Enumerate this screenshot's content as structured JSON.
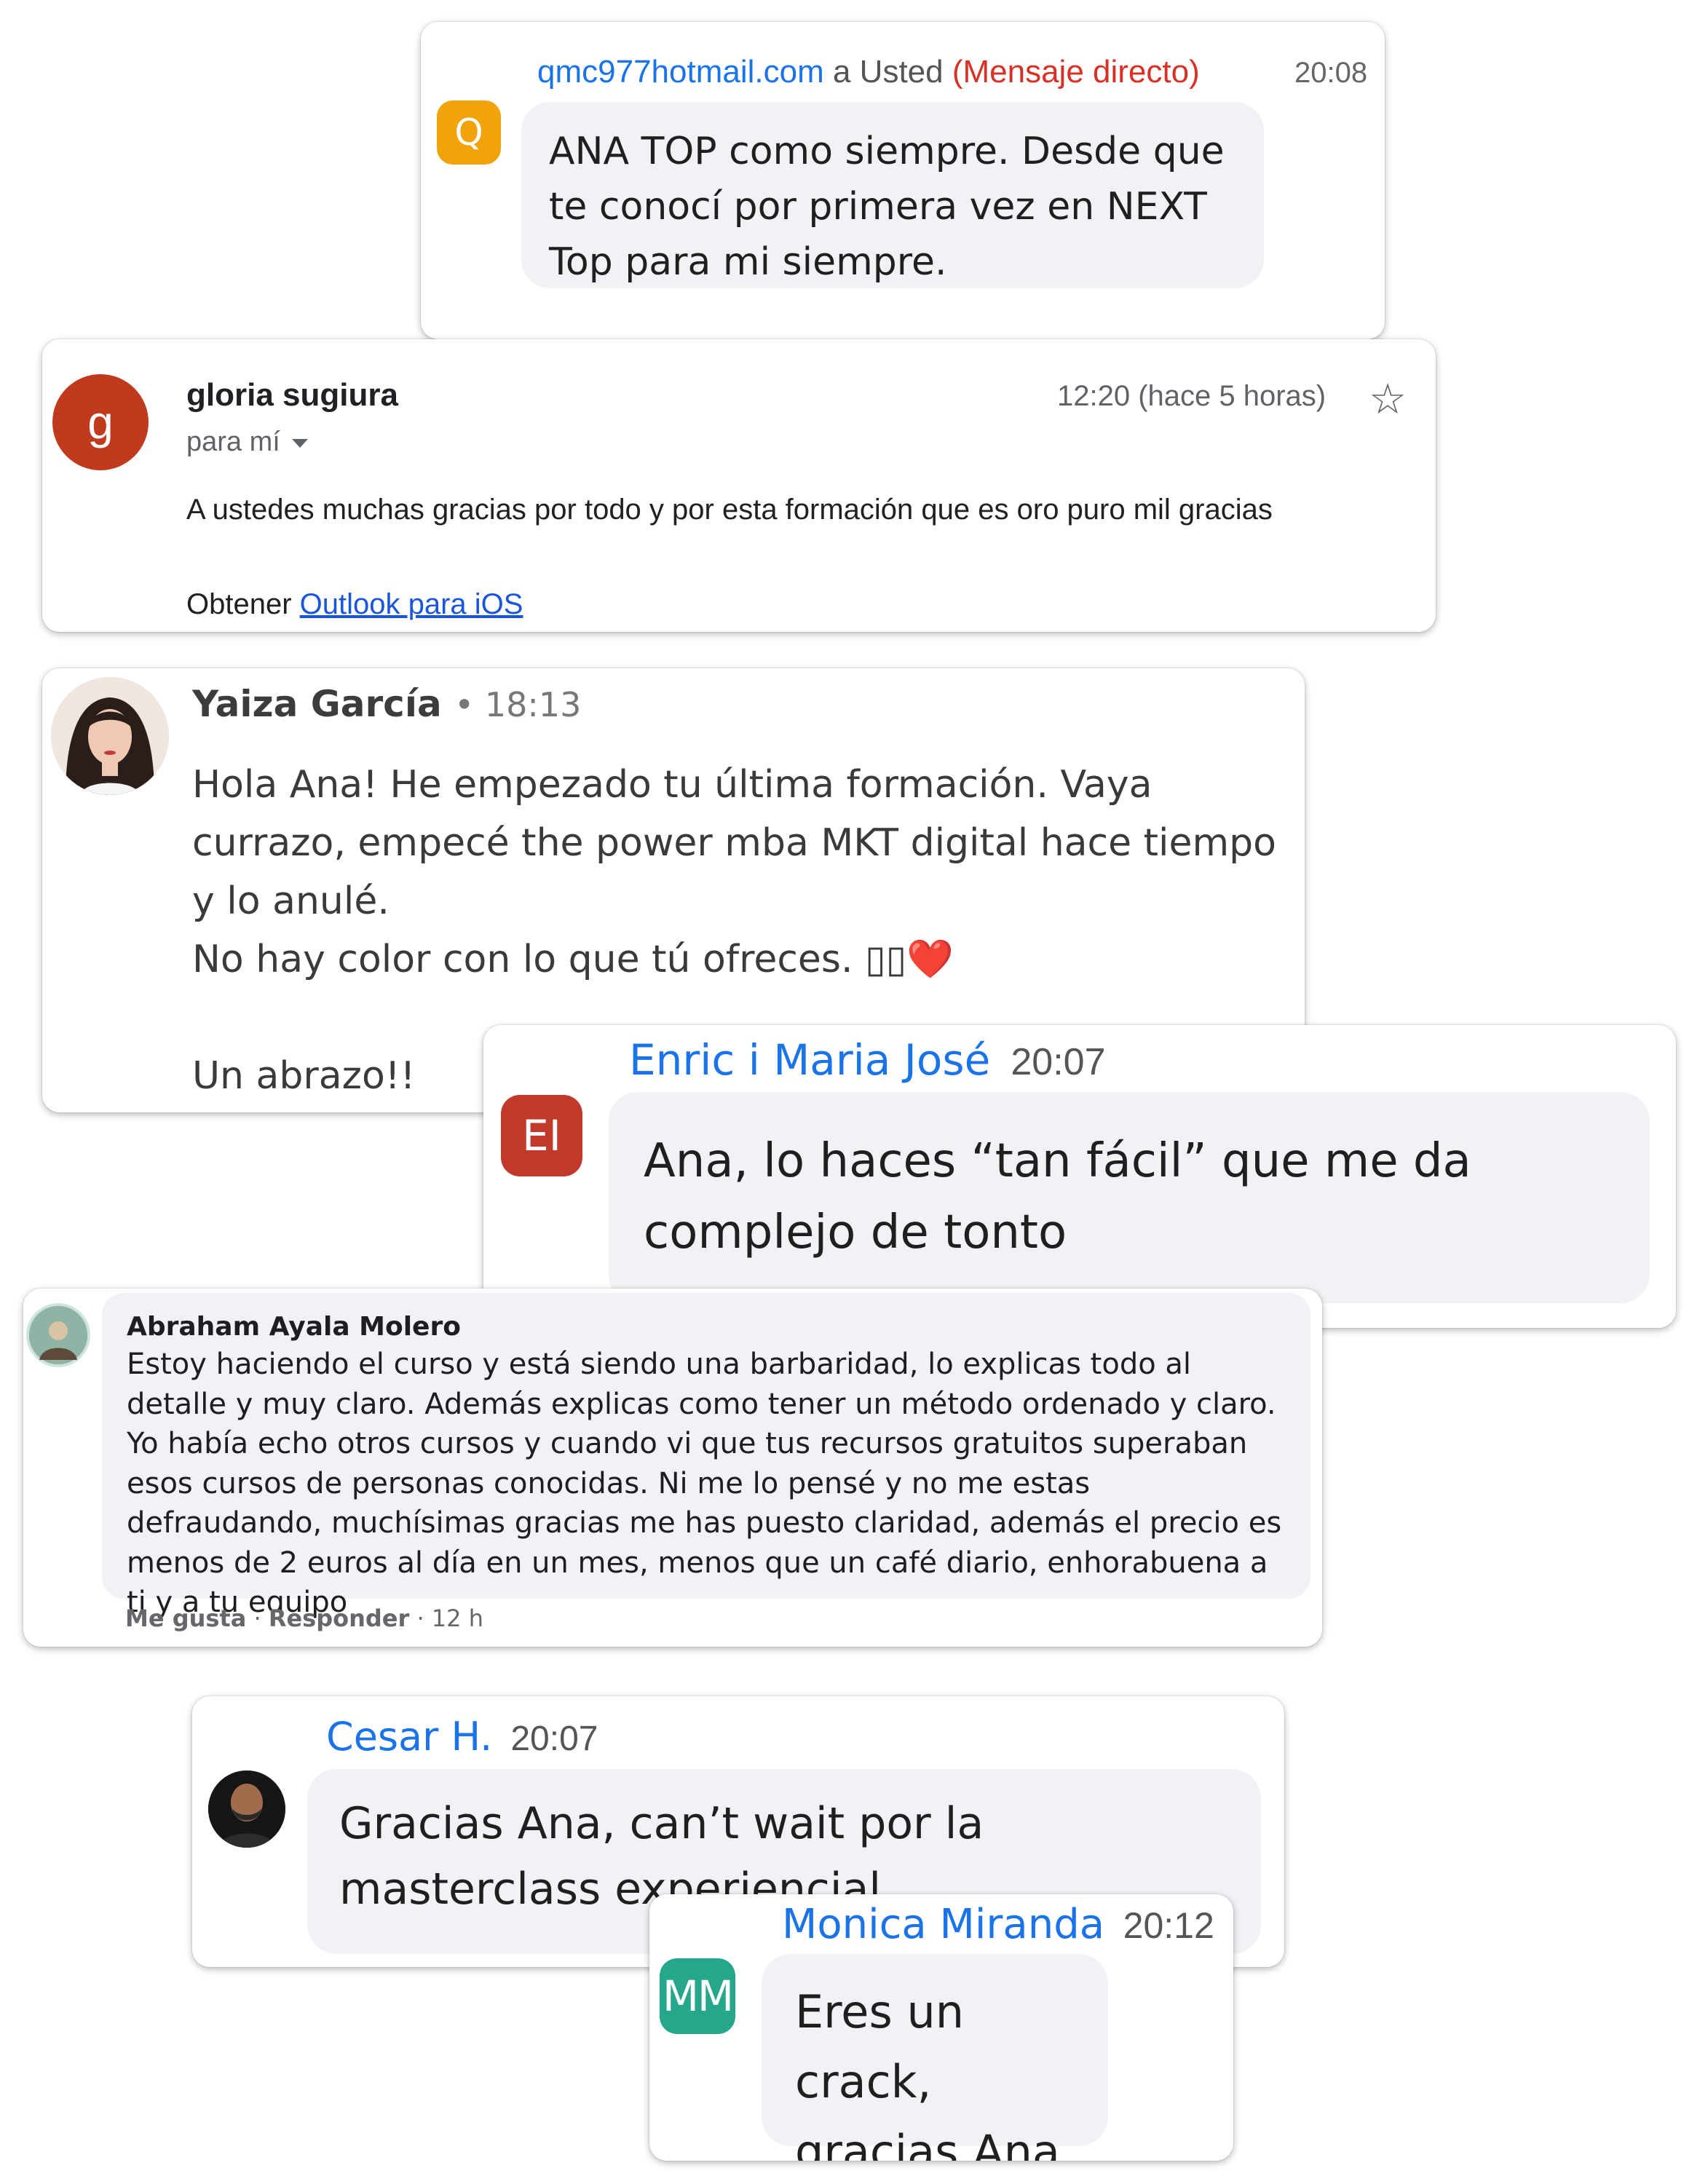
{
  "messages": {
    "qmc": {
      "avatar_letter": "Q",
      "sender": "qmc977hotmail.com",
      "to": "a Usted",
      "direct": "(Mensaje directo)",
      "time": "20:08",
      "text": "ANA TOP como siempre. Desde que te conocí por primera vez en NEXT Top para mi siempre."
    },
    "gloria": {
      "avatar_letter": "g",
      "sender": "gloria sugiura",
      "to": "para mí",
      "time": "12:20 (hace 5 horas)",
      "star": "☆",
      "body": "A ustedes muchas gracias por todo y por esta formación que es oro puro mil gracias",
      "sig_prefix": "Obtener",
      "sig_link": "Outlook para iOS"
    },
    "yaiza": {
      "sender": "Yaiza García",
      "time": "• 18:13",
      "line1": "Hola Ana! He empezado tu última formación. Vaya currazo, empecé the power mba MKT digital hace tiempo y lo anulé.",
      "line2": "No hay color con lo que tú ofreces. ▯▯❤️",
      "line3": "Un abrazo!!"
    },
    "enric": {
      "avatar_letters": "EI",
      "sender": "Enric i Maria José",
      "time": "20:07",
      "text": "Ana, lo haces “tan fácil” que me da complejo de tonto"
    },
    "abraham": {
      "sender": "Abraham Ayala Molero",
      "text": "Estoy haciendo el curso y está siendo una barbaridad, lo explicas todo al detalle y muy claro. Además explicas como tener un método ordenado y claro. Yo había echo otros cursos y cuando vi que tus recursos gratuitos superaban esos cursos de personas conocidas. Ni me lo pensé y no me estas defraudando, muchísimas gracias me has puesto claridad, además el precio es menos de 2 euros al día en un mes, menos que un café diario, enhorabuena a ti y a tu equipo",
      "like": "Me gusta",
      "reply": "Responder",
      "age": "12 h"
    },
    "cesar": {
      "sender": "Cesar H.",
      "time": "20:07",
      "text": "Gracias Ana, can’t wait por la masterclass experiencial"
    },
    "monica": {
      "avatar_letters": "MM",
      "sender": "Monica Miranda",
      "time": "20:12",
      "text": "Eres un crack, gracias Ana🥳"
    }
  },
  "colors": {
    "link_blue": "#1a73e8",
    "direct_red": "#d93025",
    "bubble_bg": "#f1f2f5",
    "avatar_orange": "#f0a30a",
    "avatar_gmail": "#c03a1e",
    "avatar_red": "#c0392b",
    "avatar_teal": "#26a68a"
  }
}
